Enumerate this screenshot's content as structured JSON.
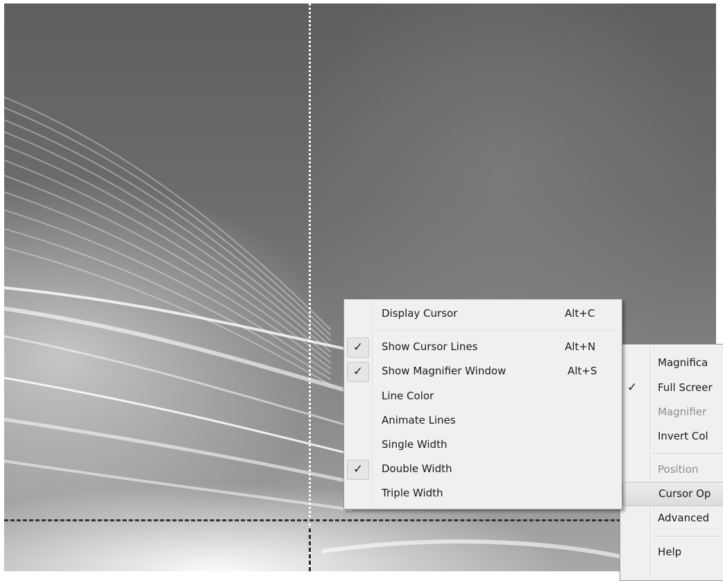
{
  "cursor_menu": {
    "items": [
      {
        "label": "Display Cursor",
        "shortcut": "Alt+C",
        "checked": false
      },
      {
        "label": "Show Cursor Lines",
        "shortcut": "Alt+N",
        "checked": true
      },
      {
        "label": "Show Magnifier Window",
        "shortcut": "Alt+S",
        "checked": true
      },
      {
        "label": "Line Color",
        "checked": false
      },
      {
        "label": "Animate Lines",
        "checked": false
      },
      {
        "label": "Single Width",
        "checked": false
      },
      {
        "label": "Double Width",
        "checked": true
      },
      {
        "label": "Triple Width",
        "checked": false
      }
    ],
    "check_glyph": "✓"
  },
  "main_menu": {
    "items": [
      {
        "label": "Magnifica",
        "checked": false,
        "disabled": false
      },
      {
        "label": "Full Screer",
        "checked": true,
        "disabled": false
      },
      {
        "label": "Magnifier",
        "checked": false,
        "disabled": true
      },
      {
        "label": "Invert Col",
        "checked": false,
        "disabled": false
      },
      {
        "label": "Position",
        "checked": false,
        "disabled": true
      },
      {
        "label": "Cursor Op",
        "checked": false,
        "disabled": false,
        "highlighted": true
      },
      {
        "label": "Advanced",
        "checked": false,
        "disabled": false
      },
      {
        "label": "Help",
        "checked": false,
        "disabled": false
      }
    ]
  },
  "colors": {
    "menu_bg": "#f0f0f0",
    "desktop": "#6c6c6c",
    "cursor_line_light": "#ffffff",
    "cursor_line_dark": "#333333"
  }
}
